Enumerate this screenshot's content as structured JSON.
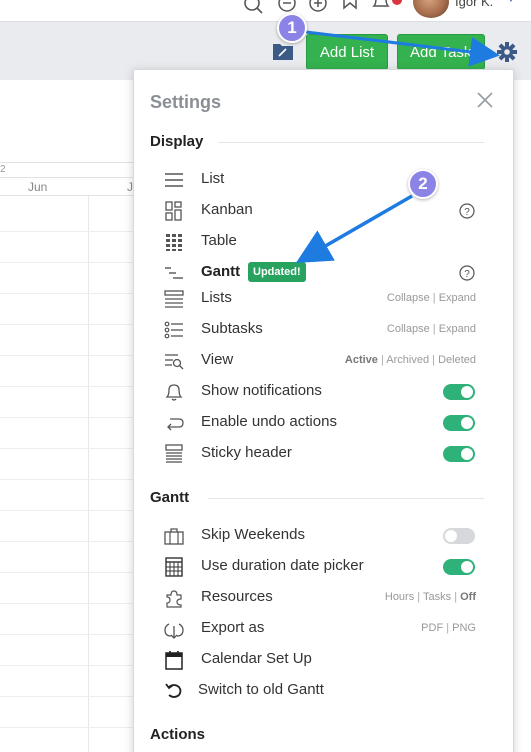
{
  "header": {
    "user_name": "Igor K.",
    "icons": [
      "search-icon",
      "minus-circle-icon",
      "plus-circle-icon",
      "bookmark-icon",
      "bell-icon"
    ]
  },
  "toolbar": {
    "add_list_label": "Add List",
    "add_task_label": "Add Task",
    "accent": "#34b24f"
  },
  "gantt_bg": {
    "year_fragment": "2",
    "months": [
      "Jun",
      "J"
    ]
  },
  "settings": {
    "title": "Settings",
    "display_section": "Display",
    "display_items": [
      {
        "label": "List",
        "icon": "list-icon"
      },
      {
        "label": "Kanban",
        "icon": "kanban-icon"
      },
      {
        "label": "Table",
        "icon": "table-grid-icon"
      },
      {
        "label": "Gantt",
        "icon": "gantt-icon",
        "badge": "Updated!"
      },
      {
        "label": "Lists",
        "icon": "lists-icon",
        "options": [
          "Collapse",
          "Expand"
        ]
      },
      {
        "label": "Subtasks",
        "icon": "subtasks-icon",
        "options": [
          "Collapse",
          "Expand"
        ]
      },
      {
        "label": "View",
        "icon": "view-filter-icon",
        "options": [
          "Active",
          "Archived",
          "Deleted"
        ],
        "active_option": "Active"
      },
      {
        "label": "Show notifications",
        "icon": "bell-outline-icon",
        "toggle": true
      },
      {
        "label": "Enable undo actions",
        "icon": "undo-icon",
        "toggle": true
      },
      {
        "label": "Sticky header",
        "icon": "sticky-header-icon",
        "toggle": true
      }
    ],
    "gantt_section": "Gantt",
    "gantt_items": [
      {
        "label": "Skip Weekends",
        "icon": "briefcase-icon",
        "toggle": false
      },
      {
        "label": "Use duration date picker",
        "icon": "calendar-grid-icon",
        "toggle": true
      },
      {
        "label": "Resources",
        "icon": "puzzle-icon",
        "options": [
          "Hours",
          "Tasks",
          "Off"
        ],
        "active_option": "Off"
      },
      {
        "label": "Export as",
        "icon": "export-download-icon",
        "options": [
          "PDF",
          "PNG"
        ]
      },
      {
        "label": "Calendar Set Up",
        "icon": "calendar-icon"
      },
      {
        "label": "Switch to old Gantt",
        "icon": "switch-back-icon"
      }
    ],
    "actions_section": "Actions",
    "toggle_on_color": "#2eb27a"
  },
  "annotations": {
    "step1": "1",
    "step2": "2",
    "arrow_color": "#1e7be0"
  }
}
